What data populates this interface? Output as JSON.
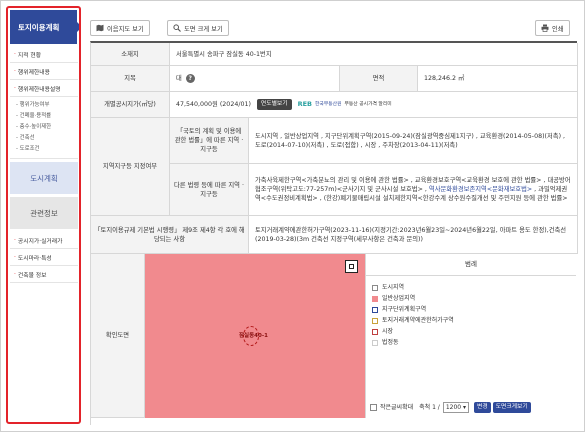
{
  "sidebar": {
    "title": "토지이용계획",
    "items_top": [
      "지적 현황",
      "행위제한내용",
      "행위제한내용설명"
    ],
    "sub_items": [
      "행위가능여부",
      "건폐율·용적률",
      "층수·높이제한",
      "건축선",
      "도로조건"
    ],
    "section_urban": "도시계획",
    "section_related": "관련정보",
    "items_bottom": [
      "공시지가·실거래가",
      "도시마라·특성",
      "건축물 정보"
    ]
  },
  "toolbar": {
    "view_btn": "이음지도 보기",
    "map_btn": "도면 크게 보기",
    "print_btn": "인쇄"
  },
  "info": {
    "address_label": "소재지",
    "address": "서울특별시 송파구 잠실동 40-1번지",
    "jimok_label": "지목",
    "jimok": "대",
    "area_label": "면적",
    "area": "128,246.2 ㎡",
    "price_label": "개별공시지가(㎡당)",
    "price": "47,540,000원 (2024/01)",
    "price_btn": "연도별보기",
    "reb_logo": "REB",
    "reb_name": "한국부동산원",
    "reb_tagline": "부동산 공시가격 알리미",
    "zone_label": "지역지구등 지정여부",
    "zone_law1_label": "「국토의 계획 및 이용에 관한 법률」에 따른 지역 · 지구등",
    "zone_law1_value": "도시지역 , 일반상업지역 , 지구단위계획구역(2015-09-24)(잠실광역중심제1지구) , 교육환경(2014-05-08)(저촉) , 도로(2014-07-10)(저촉) , 도로(접함) , 시장 , 주차장(2013-04-11)(저촉)",
    "zone_law2_label": "다른 법령 등에 따른 지역 · 지구등",
    "zone_law2_value_a": "가축사육제한구역<가축분뇨의 관리 및 이용에 관한 법률> , 교육환경보호구역<교육환경 보호에 관한 법률> , 대공방어협조구역(위탁고도:77-257m)<군사기지 및 군사시설 보호법> , ",
    "zone_law2_value_hl": "역사문화환경보존지역<문화재보호법>",
    "zone_law2_value_b": " , 과밀억제권역<수도권정비계획법> , (한강)폐기물매립시설 설치제한지역<한강수계 상수원수질개선 및 주민지원 등에 관한 법률>",
    "decree_label": "「토지이용규제 기본법 시행령」 제9조 제4항 각 호에 해당되는 사항",
    "decree_value": "토지거래계약에관한허가구역(2023-11-16)(지정기간:2023년6월23일~2024년6월22일, 아파트 용도 한정),건축선(2019-03-28)(3m 건축선 지정구역(세부사항은 건축과 문의))",
    "map_label": "확인도면"
  },
  "map": {
    "parcel_label": "잠실동40-1",
    "legend_title": "범례",
    "legend": [
      {
        "label": "도시지역",
        "color": "#ffffff",
        "border": "#8a8a8a"
      },
      {
        "label": "일반상업지역",
        "color": "#f18a8e",
        "border": "#f18a8e"
      },
      {
        "label": "지구단위계획구역",
        "color": "#ffffff",
        "border": "#2f4a9a"
      },
      {
        "label": "토지거래계약에관한허가구역",
        "color": "#ffffff",
        "border": "#c9a23a"
      },
      {
        "label": "시장",
        "color": "#ffffff",
        "border": "#c04040"
      },
      {
        "label": "법정동",
        "color": "#ffffff",
        "border": "#cccccc"
      }
    ],
    "small_check_label": "작은글씨확대",
    "scale_label": "축척 1 /",
    "scale_value": "1200",
    "change_btn": "변경",
    "enlarge_btn": "도면크게보기"
  }
}
